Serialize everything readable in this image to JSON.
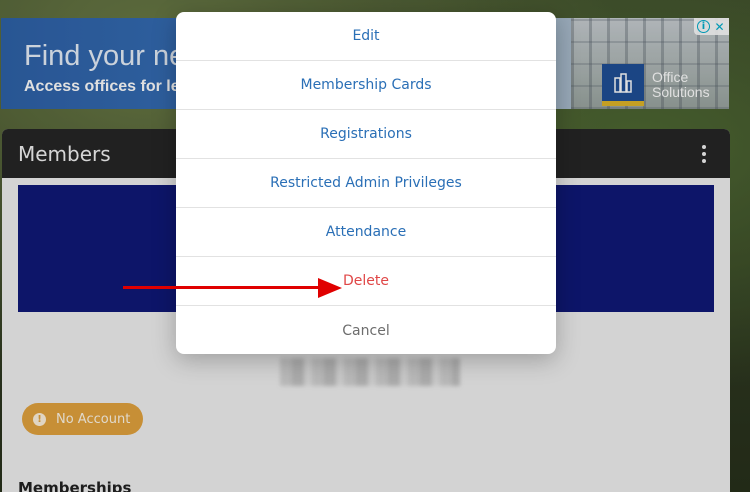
{
  "ad": {
    "headline": "Find your new",
    "subline": "Access offices for lease",
    "brand_line1": "Office",
    "brand_line2": "Solutions",
    "info_glyph": "i",
    "close_glyph": "✕"
  },
  "card": {
    "title": "Members",
    "account_status": "No Account",
    "section_title": "Memberships"
  },
  "menu": {
    "items": [
      {
        "label": "Edit",
        "style": "normal"
      },
      {
        "label": "Membership Cards",
        "style": "normal"
      },
      {
        "label": "Registrations",
        "style": "normal"
      },
      {
        "label": "Restricted Admin Privileges",
        "style": "normal"
      },
      {
        "label": "Attendance",
        "style": "normal"
      },
      {
        "label": "Delete",
        "style": "danger"
      },
      {
        "label": "Cancel",
        "style": "muted"
      }
    ]
  },
  "colors": {
    "link": "#2a6fb6",
    "danger": "#e04747",
    "banner": "#0f1878",
    "account_badge": "#e3a33e",
    "annotation_arrow": "#e00000"
  },
  "icons": {
    "kebab": "more-vertical-icon",
    "warning": "alert-circle-icon",
    "logo": "building-logo-icon"
  }
}
